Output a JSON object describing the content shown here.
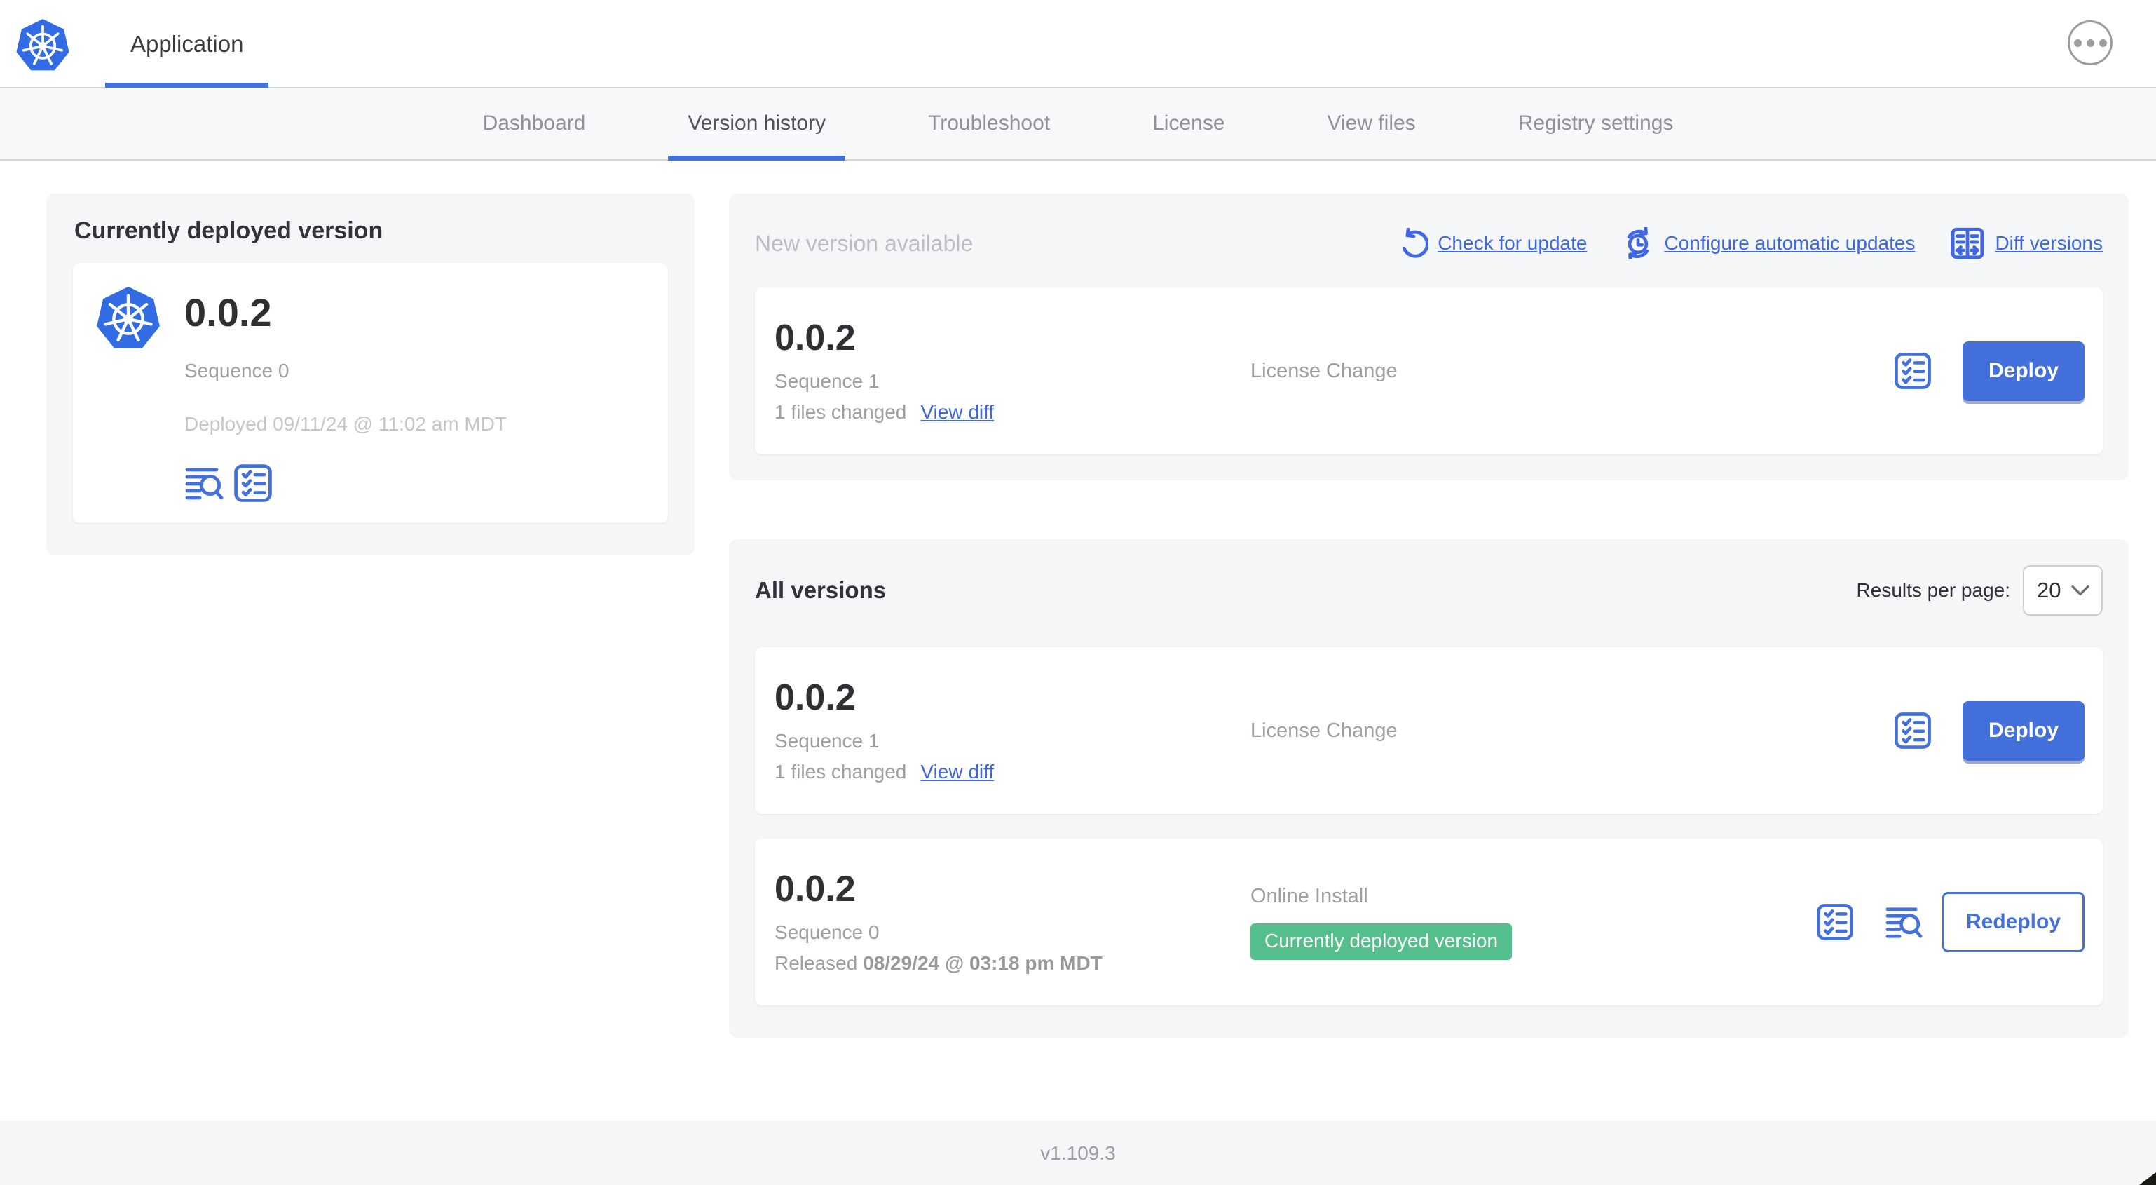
{
  "header": {
    "app_title": "Application"
  },
  "nav": {
    "tabs": [
      {
        "label": "Dashboard"
      },
      {
        "label": "Version history"
      },
      {
        "label": "Troubleshoot"
      },
      {
        "label": "License"
      },
      {
        "label": "View files"
      },
      {
        "label": "Registry settings"
      }
    ]
  },
  "current": {
    "title": "Currently deployed version",
    "version": "0.0.2",
    "sequence": "Sequence 0",
    "deployed": "Deployed 09/11/24 @ 11:02 am MDT"
  },
  "new_version": {
    "title": "New version available",
    "check_link": "Check for update",
    "auto_link": "Configure automatic updates",
    "diff_link": "Diff versions",
    "card": {
      "version": "0.0.2",
      "sequence": "Sequence 1",
      "files_changed": "1 files changed",
      "view_diff": "View diff",
      "source": "License Change",
      "deploy_label": "Deploy"
    }
  },
  "all_versions": {
    "title": "All versions",
    "results_label": "Results per page:",
    "results_value": "20",
    "rows": [
      {
        "version": "0.0.2",
        "sequence": "Sequence 1",
        "files_changed": "1 files changed",
        "view_diff": "View diff",
        "source": "License Change",
        "action_label": "Deploy"
      },
      {
        "version": "0.0.2",
        "sequence": "Sequence 0",
        "released_prefix": "Released",
        "released_date": "08/29/24 @ 03:18 pm MDT",
        "source": "Online Install",
        "badge": "Currently deployed version",
        "action_label": "Redeploy"
      }
    ]
  },
  "footer": {
    "app_version": "v1.109.3"
  },
  "colors": {
    "primary_blue": "#4470DB",
    "link_blue": "#3F66E3",
    "kubernetes_blue": "#326CE5",
    "badge_green": "#54BE8C",
    "panel_bg": "#F4F6F8",
    "muted_text": "#9C9FA3",
    "light_muted_text": "#C4C7CA",
    "dark_text": "#2F3033"
  }
}
